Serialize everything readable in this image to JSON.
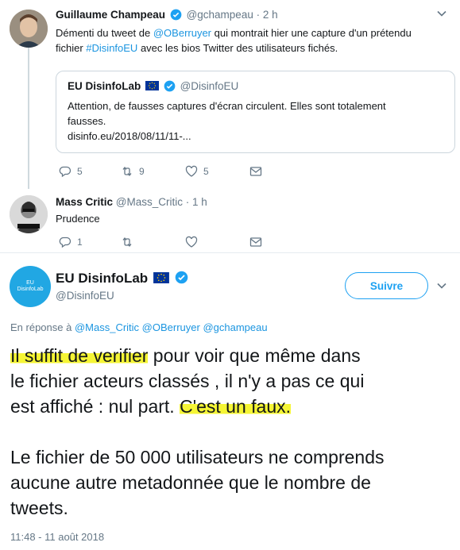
{
  "tweet1": {
    "author_name": "Guillaume Champeau",
    "author_handle": "@gchampeau",
    "time": "· 2 h",
    "text_line1_before": "Démenti du tweet de ",
    "text_line1_mention": "@OBerruyer",
    "text_line1_after": " qui montrait hier une capture d'un prétendu",
    "text_line2_before": "fichier ",
    "text_line2_hashtag": "#DisinfoEU",
    "text_line2_after": " avec les bios Twitter des utilisateurs fichés.",
    "quote": {
      "author_name": "EU DisinfoLab",
      "author_handle": "@DisinfoEU",
      "text_line1": "Attention, de fausses captures d'écran circulent. Elles sont totalement",
      "text_line2": "fausses.",
      "text_line3": "disinfo.eu/2018/08/11/11-..."
    },
    "replies": "5",
    "retweets": "9",
    "likes": "5"
  },
  "tweet2": {
    "author_name": "Mass Critic",
    "author_handle": "@Mass_Critic",
    "time": "· 1 h",
    "text": "Prudence",
    "replies": "1",
    "retweets": "",
    "likes": ""
  },
  "main": {
    "author_name": "EU DisinfoLab",
    "author_handle": "@DisinfoEU",
    "follow_label": "Suivre",
    "avatar_text": "EU DisinfoLab",
    "reply_prefix": "En réponse à",
    "reply_mentions": "@Mass_Critic @OBerruyer @gchampeau",
    "line1_hl": "Il suffit de verifier",
    "line1_rest": " pour voir que même dans",
    "line2": "le fichier acteurs classés , il n'y a pas ce qui",
    "line3_start": "est affiché : nul part. ",
    "line3_hl": "C'est un faux.",
    "line4": "Le fichier de 50 000 utilisateurs ne comprends",
    "line5": "aucune autre metadonnée que le nombre de",
    "line6": "tweets.",
    "timestamp": "11:48 - 11 août 2018"
  },
  "colors": {
    "link": "#1b95e0",
    "follow": "#1da1f2",
    "highlight": "#f5f535",
    "muted": "#657786"
  }
}
